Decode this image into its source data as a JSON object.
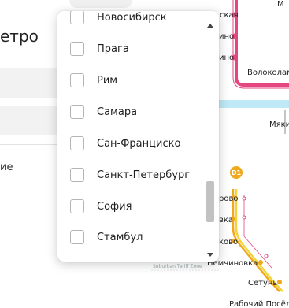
{
  "settings_panel": {
    "title_partial": "етро",
    "option_label_partial": "ие"
  },
  "city_dropdown": {
    "items": [
      {
        "label": "Новосибирск",
        "checked": false
      },
      {
        "label": "Прага",
        "checked": false
      },
      {
        "label": "Рим",
        "checked": false
      },
      {
        "label": "Самара",
        "checked": false
      },
      {
        "label": "Сан-Франциско",
        "checked": false
      },
      {
        "label": "Санкт-Петербург",
        "checked": false
      },
      {
        "label": "София",
        "checked": false
      },
      {
        "label": "Стамбул",
        "checked": false
      }
    ]
  },
  "metro_map": {
    "colors": {
      "pink_line": "#e4477f",
      "orange_line": "#f0a81c",
      "yellow_line": "#f3d53a",
      "river": "#bfe9f5",
      "gray_line": "#8a8a8a"
    },
    "route_badge": "D1",
    "zone_label": "Suburban Tariff Zone",
    "stations": {
      "s1": "ская",
      "s2": "ино",
      "s3": "ино",
      "s4": "Волоколам",
      "s5": "Мяки",
      "s6": "рово",
      "s7": "вка",
      "s8": "ково",
      "s9": "Немчиновка",
      "s10": "Сетунь",
      "s11": "Рабочий Посёл",
      "s12": "М"
    }
  }
}
